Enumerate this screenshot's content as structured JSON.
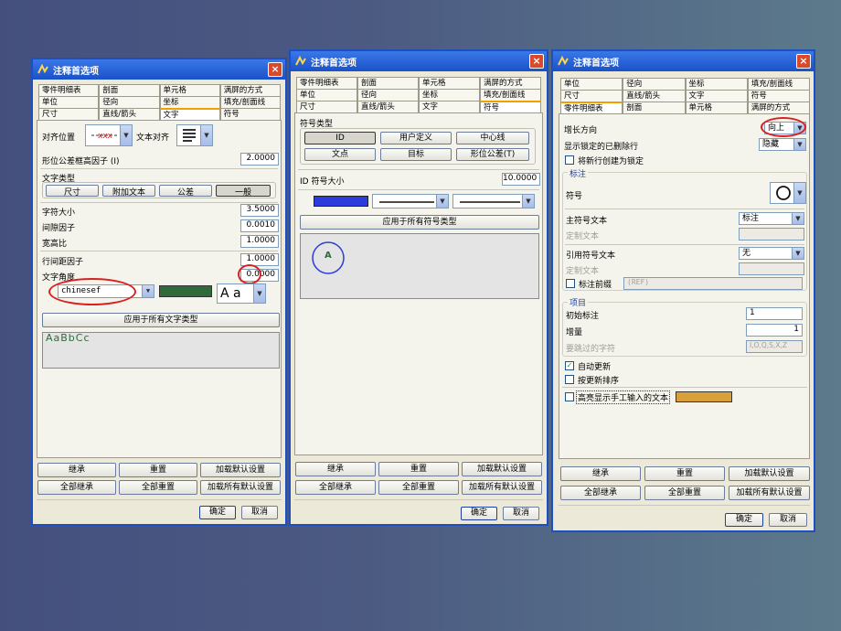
{
  "dialogs": [
    {
      "title": "注释首选项",
      "tabs_row1": [
        "零件明细表",
        "剖面",
        "单元格",
        "满屏的方式"
      ],
      "tabs_row2": [
        "单位",
        "径向",
        "坐标",
        "填充/剖面线"
      ],
      "tabs_row3": [
        "尺寸",
        "直线/箭头",
        "文字",
        "符号"
      ],
      "active_tab": "文字",
      "align_pos_label": "对齐位置",
      "text_align_label": "文本对齐",
      "gdt_factor_label": "形位公差框高因子 (I)",
      "gdt_factor_value": "2.0000",
      "text_type_label": "文字类型",
      "text_type_buttons": [
        "尺寸",
        "附加文本",
        "公差",
        "一般"
      ],
      "char_size_label": "字符大小",
      "char_size_value": "3.5000",
      "gap_factor_label": "间隙因子",
      "gap_factor_value": "0.0010",
      "aspect_label": "宽高比",
      "aspect_value": "1.0000",
      "line_space_label": "行间距因子",
      "line_space_value": "1.0000",
      "text_angle_label": "文字角度",
      "text_angle_value": "0.0000",
      "font_value": "chinesef",
      "font_style": "A a",
      "apply_all_text": "应用于所有文字类型",
      "preview_text": "AaBbCc",
      "buttons": [
        "继承",
        "重置",
        "加载默认设置",
        "全部继承",
        "全部重置",
        "加载所有默认设置"
      ],
      "ok": "确定",
      "cancel": "取消"
    },
    {
      "title": "注释首选项",
      "tabs_row1": [
        "零件明细表",
        "剖面",
        "单元格",
        "满屏的方式"
      ],
      "tabs_row2": [
        "单位",
        "径向",
        "坐标",
        "填充/剖面线"
      ],
      "tabs_row3": [
        "尺寸",
        "直线/箭头",
        "文字",
        "符号"
      ],
      "active_tab": "符号",
      "symbol_type_label": "符号类型",
      "symbol_buttons": [
        "ID",
        "用户定义",
        "中心线",
        "文点",
        "目标",
        "形位公差(T)"
      ],
      "id_size_label": "ID 符号大小",
      "id_size_value": "10.0000",
      "apply_all_symbol": "应用于所有符号类型",
      "preview_symbol": "A",
      "buttons": [
        "继承",
        "重置",
        "加载默认设置",
        "全部继承",
        "全部重置",
        "加载所有默认设置"
      ],
      "ok": "确定",
      "cancel": "取消"
    },
    {
      "title": "注释首选项",
      "tabs_row1": [
        "单位",
        "径向",
        "坐标",
        "填充/剖面线"
      ],
      "tabs_row2": [
        "尺寸",
        "直线/箭头",
        "文字",
        "符号"
      ],
      "tabs_row3": [
        "零件明细表",
        "剖面",
        "单元格",
        "满屏的方式"
      ],
      "active_tab": "零件明细表",
      "grow_dir_label": "增长方向",
      "grow_dir_value": "向上",
      "show_locked_label": "显示锁定的已删除行",
      "show_locked_value": "隐藏",
      "lock_new_label": "将新行创建为锁定",
      "label_group": "标注",
      "symbol_label": "符号",
      "main_symbol_text_label": "主符号文本",
      "main_symbol_text_value": "标注",
      "custom_text_label": "定制文本",
      "ref_symbol_text_label": "引用符号文本",
      "ref_symbol_text_value": "无",
      "custom_text_label2": "定制文本",
      "prefix_label": "标注前缀",
      "prefix_value": "(REF)",
      "items_group": "项目",
      "initial_label": "初始标注",
      "initial_value": "1",
      "increment_label": "增量",
      "increment_value": "1",
      "skip_chars_label": "要跳过的字符",
      "skip_chars_value": "I,O,Q,S,X,Z",
      "auto_update_label": "自动更新",
      "update_sort_label": "按更新排序",
      "highlight_manual_label": "高亮显示手工输入的文本",
      "highlight_color": "#d9a03a",
      "buttons": [
        "继承",
        "重置",
        "加载默认设置",
        "全部继承",
        "全部重置",
        "加载所有默认设置"
      ],
      "ok": "确定",
      "cancel": "取消"
    }
  ],
  "colors": {
    "annotation": "#d8201f",
    "text_color_swatch": "#2f6a3a",
    "symbol_color_swatch": "#2b3bdc"
  }
}
